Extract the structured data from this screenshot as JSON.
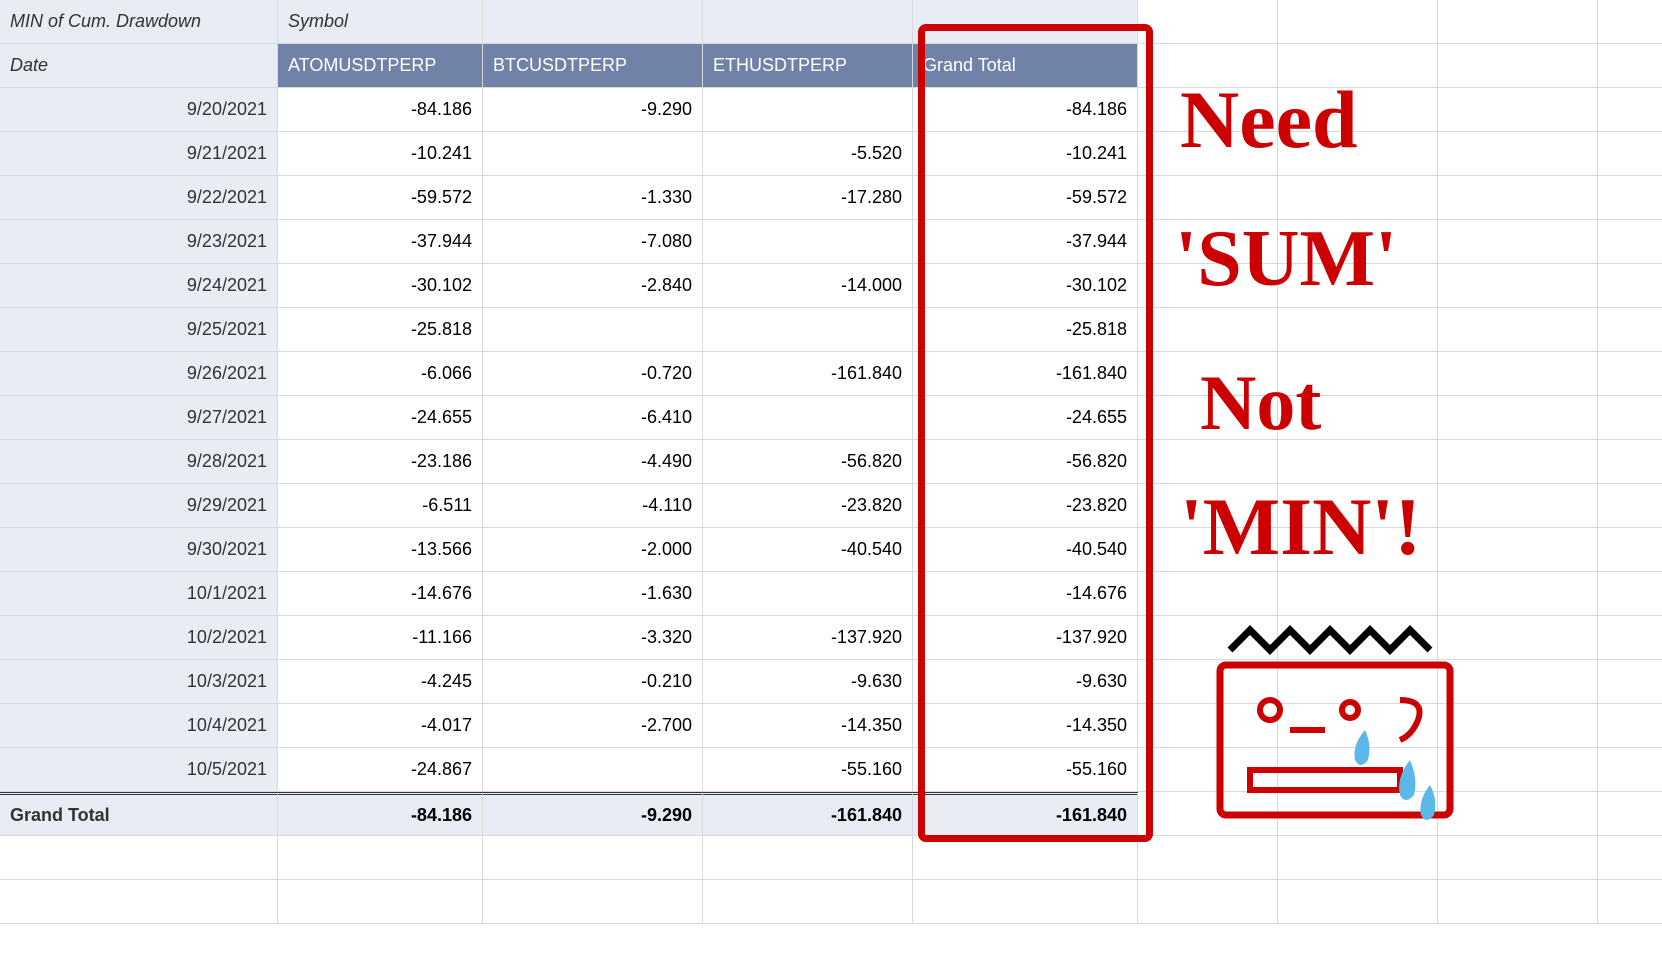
{
  "pivot": {
    "title": "MIN of Cum. Drawdown",
    "colField": "Symbol",
    "rowField": "Date",
    "columns": [
      "ATOMUSDTPERP",
      "BTCUSDTPERP",
      "ETHUSDTPERP",
      "Grand Total"
    ],
    "rows": [
      {
        "date": "9/20/2021",
        "vals": [
          "-84.186",
          "-9.290",
          "",
          "-84.186"
        ]
      },
      {
        "date": "9/21/2021",
        "vals": [
          "-10.241",
          "",
          "-5.520",
          "-10.241"
        ]
      },
      {
        "date": "9/22/2021",
        "vals": [
          "-59.572",
          "-1.330",
          "-17.280",
          "-59.572"
        ]
      },
      {
        "date": "9/23/2021",
        "vals": [
          "-37.944",
          "-7.080",
          "",
          "-37.944"
        ]
      },
      {
        "date": "9/24/2021",
        "vals": [
          "-30.102",
          "-2.840",
          "-14.000",
          "-30.102"
        ]
      },
      {
        "date": "9/25/2021",
        "vals": [
          "-25.818",
          "",
          "",
          "-25.818"
        ]
      },
      {
        "date": "9/26/2021",
        "vals": [
          "-6.066",
          "-0.720",
          "-161.840",
          "-161.840"
        ]
      },
      {
        "date": "9/27/2021",
        "vals": [
          "-24.655",
          "-6.410",
          "",
          "-24.655"
        ]
      },
      {
        "date": "9/28/2021",
        "vals": [
          "-23.186",
          "-4.490",
          "-56.820",
          "-56.820"
        ]
      },
      {
        "date": "9/29/2021",
        "vals": [
          "-6.511",
          "-4.110",
          "-23.820",
          "-23.820"
        ]
      },
      {
        "date": "9/30/2021",
        "vals": [
          "-13.566",
          "-2.000",
          "-40.540",
          "-40.540"
        ]
      },
      {
        "date": "10/1/2021",
        "vals": [
          "-14.676",
          "-1.630",
          "",
          "-14.676"
        ]
      },
      {
        "date": "10/2/2021",
        "vals": [
          "-11.166",
          "-3.320",
          "-137.920",
          "-137.920"
        ]
      },
      {
        "date": "10/3/2021",
        "vals": [
          "-4.245",
          "-0.210",
          "-9.630",
          "-9.630"
        ]
      },
      {
        "date": "10/4/2021",
        "vals": [
          "-4.017",
          "-2.700",
          "-14.350",
          "-14.350"
        ]
      },
      {
        "date": "10/5/2021",
        "vals": [
          "-24.867",
          "",
          "-55.160",
          "-55.160"
        ]
      }
    ],
    "grandTotalLabel": "Grand Total",
    "grandTotals": [
      "-84.186",
      "-9.290",
      "-161.840",
      "-161.840"
    ]
  },
  "annotation": {
    "line1": "Need",
    "line2": "'SUM'",
    "line3": "Not",
    "line4": "'MIN'!"
  }
}
